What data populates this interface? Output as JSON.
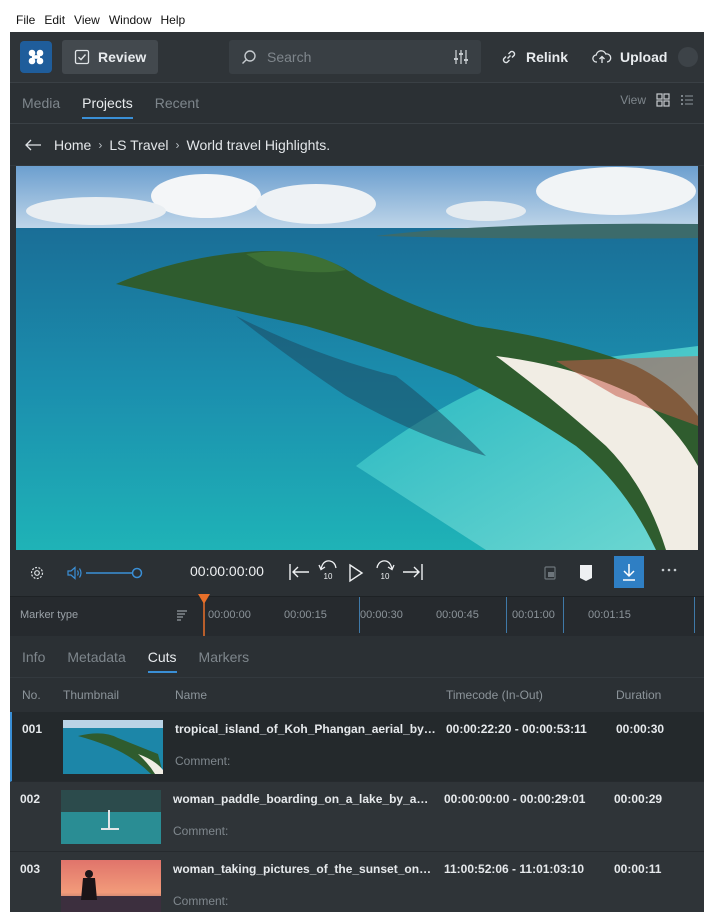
{
  "menu": [
    "File",
    "Edit",
    "View",
    "Window",
    "Help"
  ],
  "toolbar": {
    "review_label": "Review",
    "search_placeholder": "Search",
    "relink_label": "Relink",
    "upload_label": "Upload"
  },
  "nav": {
    "tabs": [
      "Media",
      "Projects",
      "Recent"
    ],
    "active": "Projects",
    "view_label": "View"
  },
  "breadcrumb": [
    "Home",
    "LS Travel",
    "World travel Highlights."
  ],
  "player": {
    "timecode": "00:00:00:00",
    "rewind_label": "10",
    "forward_label": "10"
  },
  "markers": {
    "type_label": "Marker type",
    "ticks": [
      "00:00:00",
      "00:00:15",
      "00:00:30",
      "00:00:45",
      "00:01:00",
      "00:01:15"
    ]
  },
  "detail_tabs": {
    "tabs": [
      "Info",
      "Metadata",
      "Cuts",
      "Markers"
    ],
    "active": "Cuts"
  },
  "table": {
    "columns": [
      "No.",
      "Thumbnail",
      "Name",
      "Timecode (In-Out)",
      "Duration"
    ],
    "rows": [
      {
        "no": "001",
        "name": "tropical_island_of_Koh_Phangan_aerial_by_Rom...",
        "comment": "Comment:",
        "timecode": "00:00:22:20 - 00:00:53:11",
        "duration": "00:00:30"
      },
      {
        "no": "002",
        "name": "woman_paddle_boarding_on_a_lake_by_a_moun...",
        "comment": "Comment:",
        "timecode": "00:00:00:00 - 00:00:29:01",
        "duration": "00:00:29"
      },
      {
        "no": "003",
        "name": "woman_taking_pictures_of_the_sunset_on_the_...",
        "comment": "Comment:",
        "timecode": "11:00:52:06 - 11:01:03:10",
        "duration": "00:00:11"
      }
    ]
  },
  "colors": {
    "accent": "#3a8fd6",
    "playhead": "#e8702a",
    "logo": "#1f5d9b"
  }
}
